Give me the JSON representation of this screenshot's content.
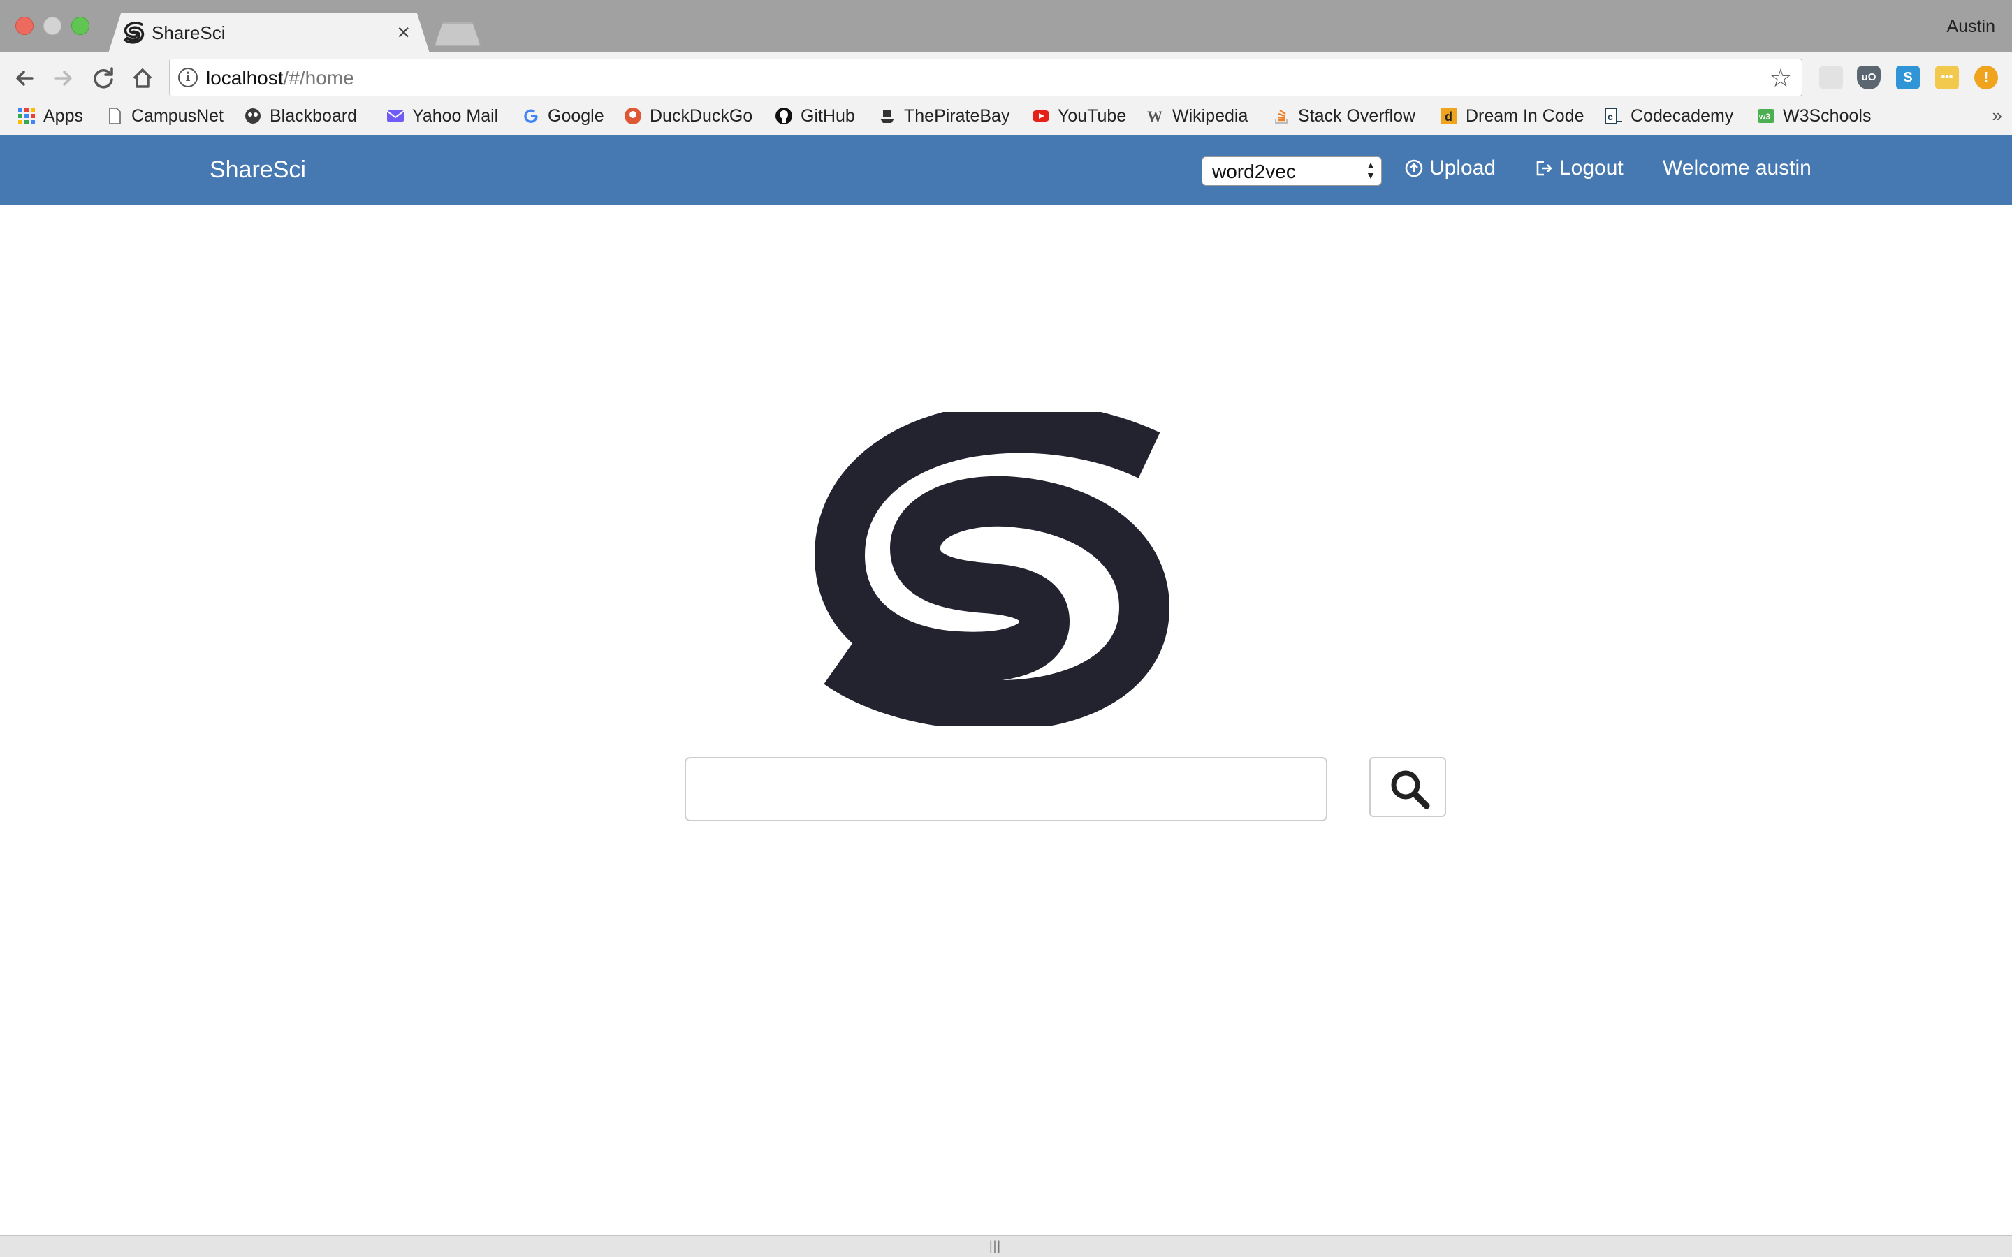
{
  "browser": {
    "tab_title": "ShareSci",
    "tab_close": "×",
    "profile_name": "Austin",
    "url_host": "localhost",
    "url_path": "/#/home"
  },
  "bookmarks": [
    {
      "label": "Apps",
      "icon": "apps-grid-icon",
      "color": "#4285f4"
    },
    {
      "label": "CampusNet",
      "icon": "page-icon",
      "color": "#ffffff"
    },
    {
      "label": "Blackboard",
      "icon": "blackboard-icon",
      "color": "#3b3b3b"
    },
    {
      "label": "Yahoo Mail",
      "icon": "mail-icon",
      "color": "#6f5cf6"
    },
    {
      "label": "Google",
      "icon": "google-icon",
      "color": "#4285f4"
    },
    {
      "label": "DuckDuckGo",
      "icon": "duckduckgo-icon",
      "color": "#de5833"
    },
    {
      "label": "GitHub",
      "icon": "github-icon",
      "color": "#111111"
    },
    {
      "label": "ThePirateBay",
      "icon": "pirate-ship-icon",
      "color": "#333333"
    },
    {
      "label": "YouTube",
      "icon": "youtube-icon",
      "color": "#e62117"
    },
    {
      "label": "Wikipedia",
      "icon": "wikipedia-icon",
      "color": "#555555"
    },
    {
      "label": "Stack Overflow",
      "icon": "stackoverflow-icon",
      "color": "#f48024"
    },
    {
      "label": "Dream In Code",
      "icon": "dreamincode-icon",
      "color": "#f0a31c"
    },
    {
      "label": "Codecademy",
      "icon": "codecademy-icon",
      "color": "#204056"
    },
    {
      "label": "W3Schools",
      "icon": "w3schools-icon",
      "color": "#4caf50"
    }
  ],
  "bookmarks_more": "»",
  "app": {
    "brand": "ShareSci",
    "model_select_value": "word2vec",
    "upload_label": "Upload",
    "logout_label": "Logout",
    "welcome_label": "Welcome austin",
    "navbar_color": "#4679b2",
    "logo_color": "#23222f"
  },
  "search": {
    "value": "",
    "placeholder": ""
  },
  "footer": {
    "grip": "|||"
  }
}
